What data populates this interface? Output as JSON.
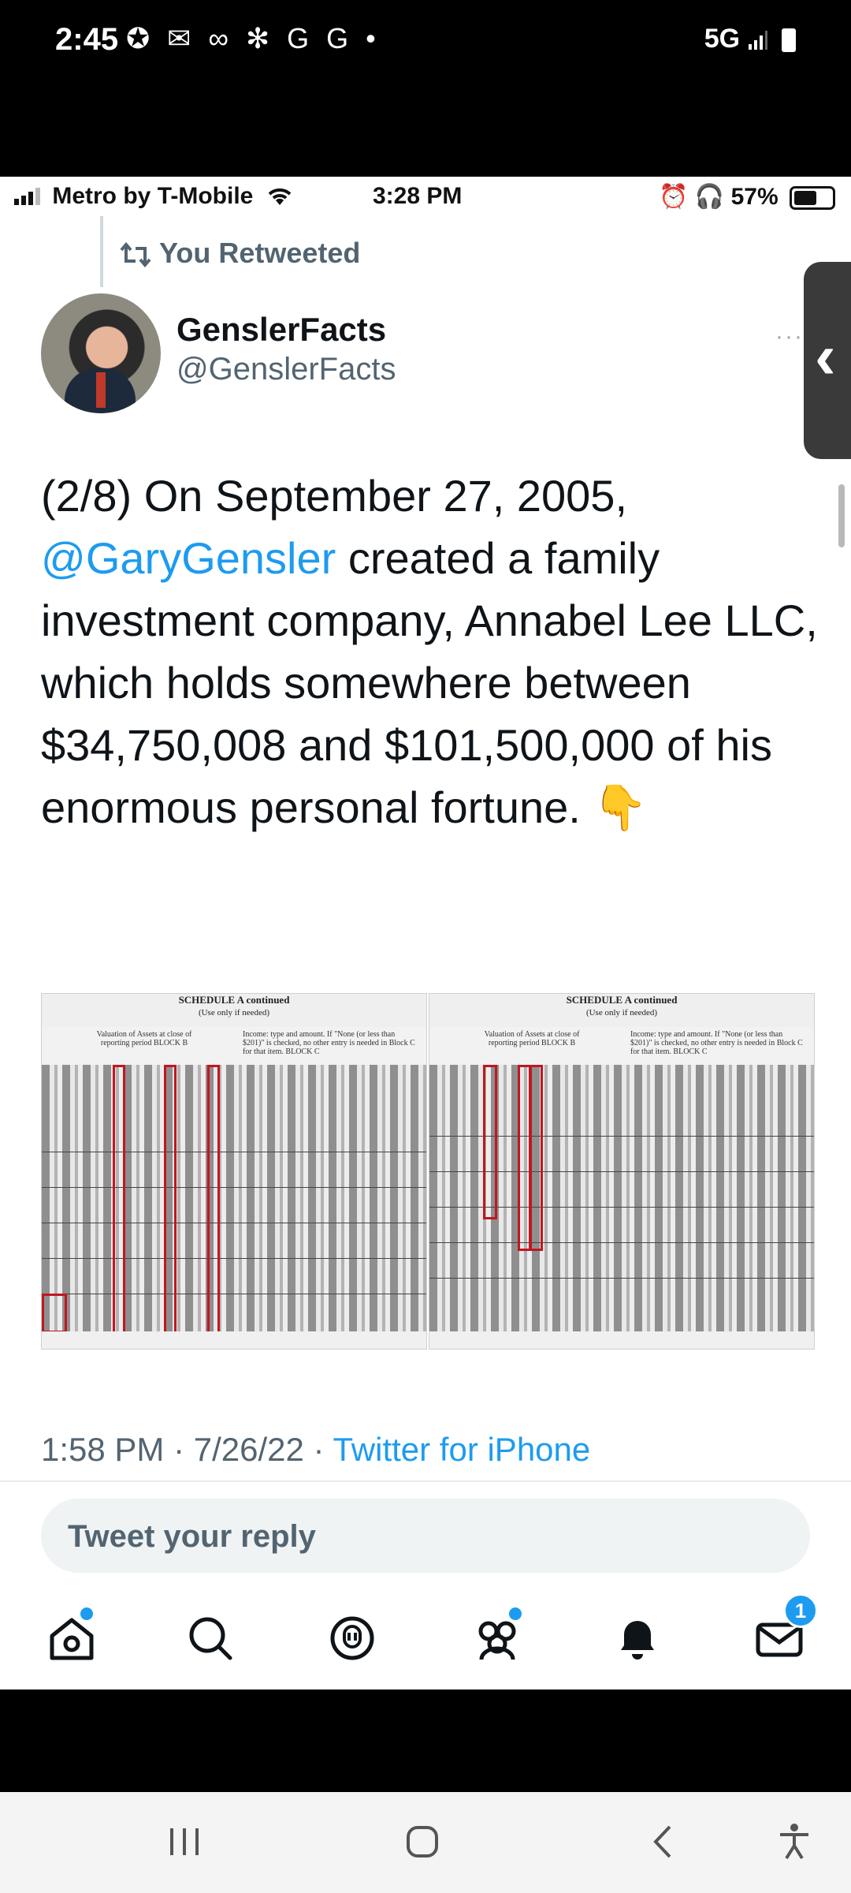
{
  "android_status": {
    "time": "2:45",
    "icons": "✪ ✉ ∞ ✻ G G •",
    "network": "5G"
  },
  "ios_status": {
    "carrier": "Metro by T-Mobile",
    "time": "3:28 PM",
    "battery": "57%"
  },
  "tweet": {
    "retweet_label": "You Retweeted",
    "author_name": "GenslerFacts",
    "author_handle": "@GenslerFacts",
    "text_prefix": "(2/8) On September 27, 2005,",
    "mention": "@GaryGensler",
    "text_suffix": " created a family investment company, Annabel Lee LLC, which holds somewhere between $34,750,008 and $101,500,000 of his enormous personal fortune.",
    "emoji": "👇",
    "timestamp": "1:58 PM · 7/26/22 · ",
    "source": "Twitter for iPhone"
  },
  "images": {
    "left": {
      "title": "SCHEDULE A continued",
      "subtitle": "(Use only if needed)",
      "block_b": "Valuation of Assets at close of reporting period BLOCK B",
      "block_c": "Income: type and amount. If \"None (or less than $201)\" is checked, no other entry is needed in Block C for that item. BLOCK C"
    },
    "right": {
      "title": "SCHEDULE A continued",
      "subtitle": "(Use only if needed)",
      "block_b": "Valuation of Assets at close of reporting period BLOCK B",
      "block_c": "Income: type and amount. If \"None (or less than $201)\" is checked, no other entry is needed in Block C for that item. BLOCK C"
    }
  },
  "reply": {
    "placeholder": "Tweet your reply"
  },
  "tabbar": {
    "messages_badge": "1"
  },
  "colors": {
    "accent": "#1d9bf0",
    "text": "#0f1419",
    "muted": "#536471",
    "highlight_red": "#c0171f"
  }
}
